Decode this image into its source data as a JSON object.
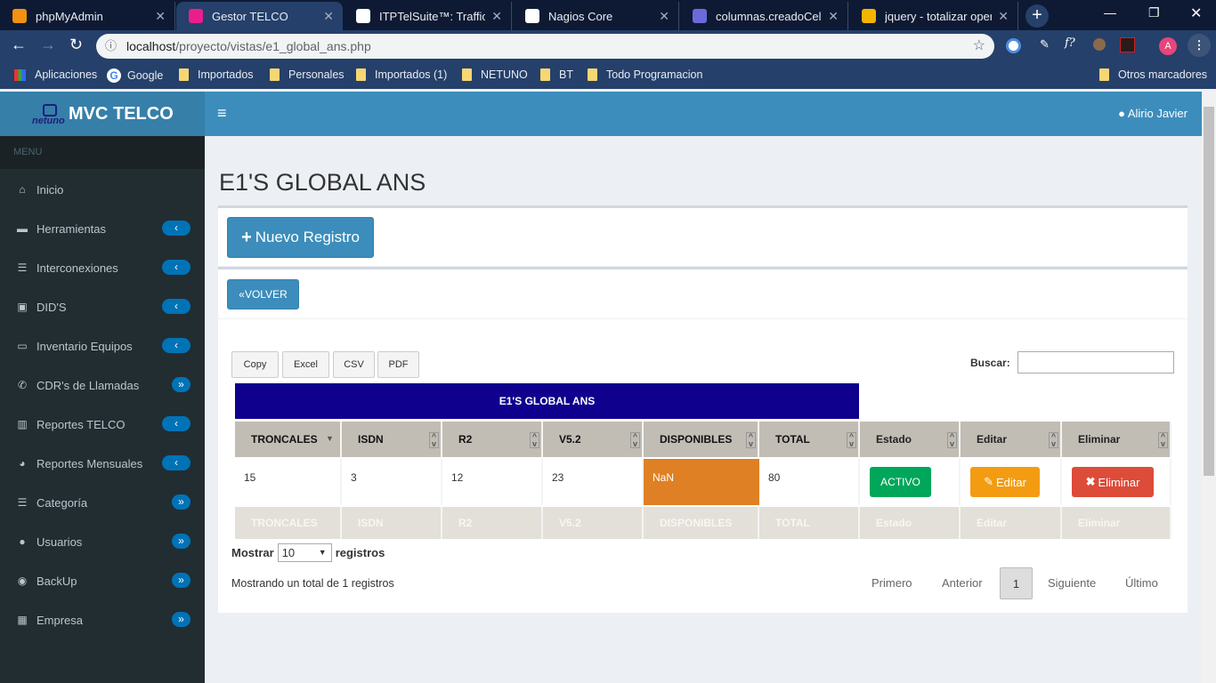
{
  "browser": {
    "tabs": [
      {
        "title": "phpMyAdmin",
        "icon": "phpmyadmin-icon",
        "color": "#f29111"
      },
      {
        "title": "Gestor TELCO",
        "icon": "wamp-icon",
        "color": "#e91e8c",
        "active": true
      },
      {
        "title": "ITPTelSuite™: Traffic Rep",
        "icon": "globe-icon",
        "color": "#ffffff"
      },
      {
        "title": "Nagios Core",
        "icon": "nagios-icon",
        "color": "#ffffff"
      },
      {
        "title": "columnas.creadoCell",
        "icon": "circle-icon",
        "color": "#6a6adb"
      },
      {
        "title": "jquery - totalizar operac",
        "icon": "stackoverflow-icon",
        "color": "#f4b400"
      }
    ],
    "url_host": "localhost",
    "url_path": "/proyecto/vistas/e1_global_ans.php",
    "profile_initial": "A",
    "bookmarks": [
      "Aplicaciones",
      "Google",
      "Importados",
      "Personales",
      "Importados (1)",
      "NETUNO",
      "BT",
      "Todo Programacion"
    ],
    "other_bookmarks": "Otros marcadores"
  },
  "app": {
    "brand": "MVC TELCO",
    "logo_text": "netuno",
    "user": "Alirio Javier",
    "menu_label": "MENU",
    "sidebar": [
      {
        "label": "Inicio",
        "icon": "home-icon",
        "glyph": "⌂",
        "badge": ""
      },
      {
        "label": "Herramientas",
        "icon": "briefcase-icon",
        "glyph": "▬",
        "badge": "‹"
      },
      {
        "label": "Interconexiones",
        "icon": "list-icon",
        "glyph": "☰",
        "badge": "‹"
      },
      {
        "label": "DID'S",
        "icon": "contact-book-icon",
        "glyph": "▣",
        "badge": "‹"
      },
      {
        "label": "Inventario Equipos",
        "icon": "laptop-icon",
        "glyph": "▭",
        "badge": "‹"
      },
      {
        "label": "CDR's de Llamadas",
        "icon": "phone-volume-icon",
        "glyph": "✆",
        "badge": "»"
      },
      {
        "label": "Reportes TELCO",
        "icon": "bar-chart-icon",
        "glyph": "▥",
        "badge": "‹"
      },
      {
        "label": "Reportes Mensuales",
        "icon": "pie-chart-icon",
        "glyph": "◕",
        "badge": "‹"
      },
      {
        "label": "Categoría",
        "icon": "list-icon",
        "glyph": "☰",
        "badge": "»"
      },
      {
        "label": "Usuarios",
        "icon": "user-icon",
        "glyph": "●",
        "badge": "»"
      },
      {
        "label": "BackUp",
        "icon": "database-icon",
        "glyph": "◉",
        "badge": "»"
      },
      {
        "label": "Empresa",
        "icon": "building-icon",
        "glyph": "▦",
        "badge": "»"
      }
    ],
    "page_title": "E1'S GLOBAL ANS",
    "new_button": "Nuevo Registro",
    "back_button": "VOLVER",
    "export_buttons": [
      "Copy",
      "Excel",
      "CSV",
      "PDF"
    ],
    "search_label": "Buscar:",
    "search_value": "",
    "table": {
      "caption": "E1'S GLOBAL ANS",
      "headers": [
        "TRONCALES",
        "ISDN",
        "R2",
        "V5.2",
        "DISPONIBLES",
        "TOTAL",
        "Estado",
        "Editar",
        "Eliminar"
      ],
      "rows": [
        {
          "troncales": "15",
          "isdn": "3",
          "r2": "12",
          "v52": "23",
          "disponibles": "NaN",
          "total": "80",
          "estado": "ACTIVO",
          "editar": "Editar",
          "eliminar": "Eliminar"
        }
      ]
    },
    "length": {
      "prefix": "Mostrar",
      "value": "10",
      "suffix": "registros"
    },
    "info": "Mostrando un total de 1 registros",
    "pagination": [
      "Primero",
      "Anterior",
      "1",
      "Siguiente",
      "Último"
    ],
    "colors": {
      "header": "#3c8dbc",
      "sidebar": "#222d32",
      "caption": "#0f008e",
      "activo": "#00a65a",
      "editar": "#f39c12",
      "eliminar": "#dd4b39",
      "nan_cell": "#e08024"
    }
  }
}
